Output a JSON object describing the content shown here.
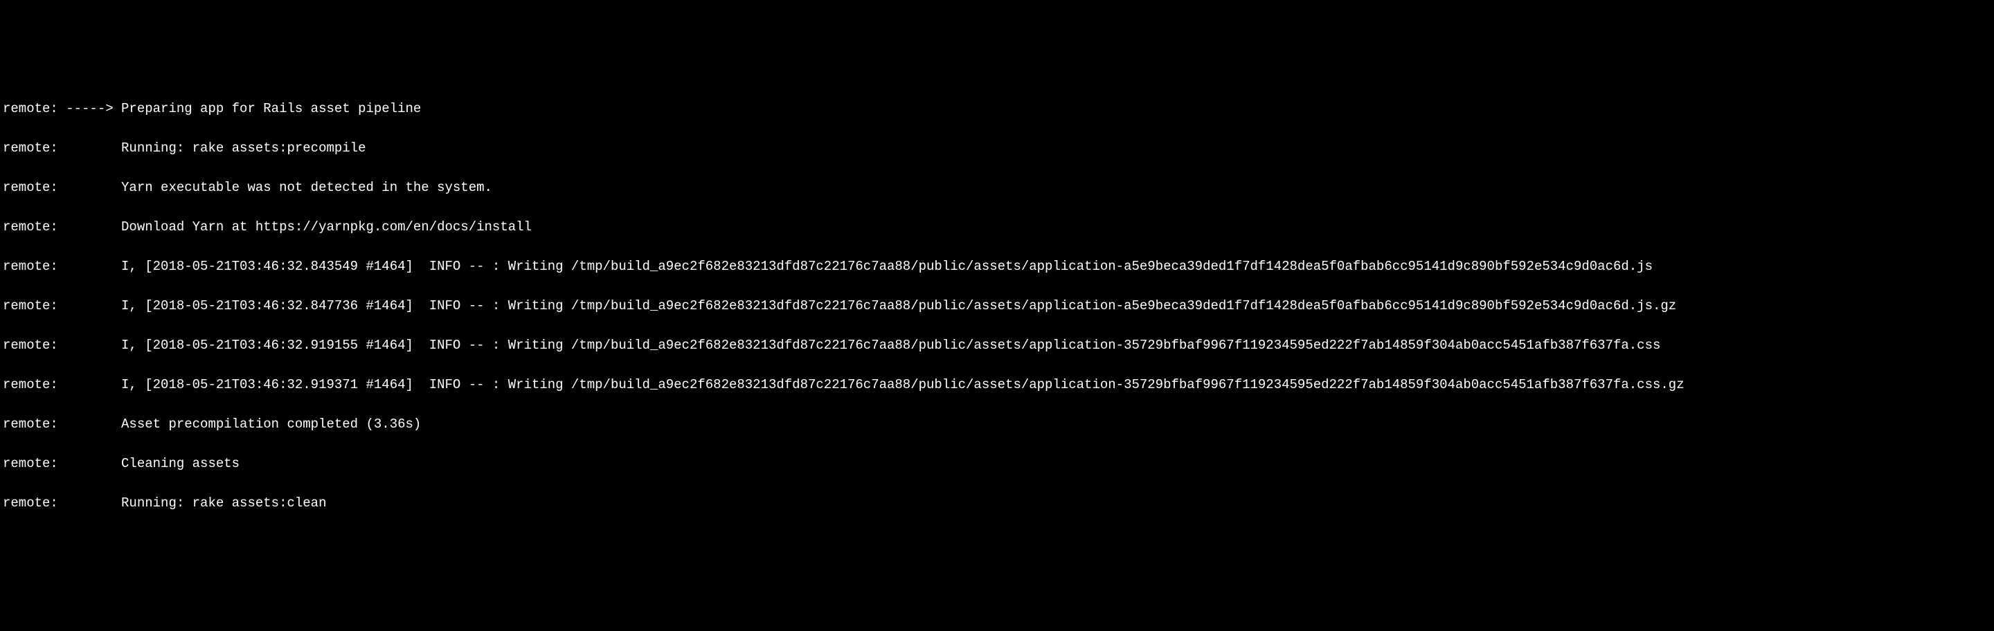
{
  "terminal": {
    "lines": [
      "remote: -----> Preparing app for Rails asset pipeline",
      "remote:        Running: rake assets:precompile",
      "remote:        Yarn executable was not detected in the system.",
      "remote:        Download Yarn at https://yarnpkg.com/en/docs/install",
      "remote:        I, [2018-05-21T03:46:32.843549 #1464]  INFO -- : Writing /tmp/build_a9ec2f682e83213dfd87c22176c7aa88/public/assets/application-a5e9beca39ded1f7df1428dea5f0afbab6cc95141d9c890bf592e534c9d0ac6d.js",
      "remote:        I, [2018-05-21T03:46:32.847736 #1464]  INFO -- : Writing /tmp/build_a9ec2f682e83213dfd87c22176c7aa88/public/assets/application-a5e9beca39ded1f7df1428dea5f0afbab6cc95141d9c890bf592e534c9d0ac6d.js.gz",
      "remote:        I, [2018-05-21T03:46:32.919155 #1464]  INFO -- : Writing /tmp/build_a9ec2f682e83213dfd87c22176c7aa88/public/assets/application-35729bfbaf9967f119234595ed222f7ab14859f304ab0acc5451afb387f637fa.css",
      "remote:        I, [2018-05-21T03:46:32.919371 #1464]  INFO -- : Writing /tmp/build_a9ec2f682e83213dfd87c22176c7aa88/public/assets/application-35729bfbaf9967f119234595ed222f7ab14859f304ab0acc5451afb387f637fa.css.gz",
      "remote:        Asset precompilation completed (3.36s)",
      "remote:        Cleaning assets",
      "remote:        Running: rake assets:clean"
    ]
  }
}
